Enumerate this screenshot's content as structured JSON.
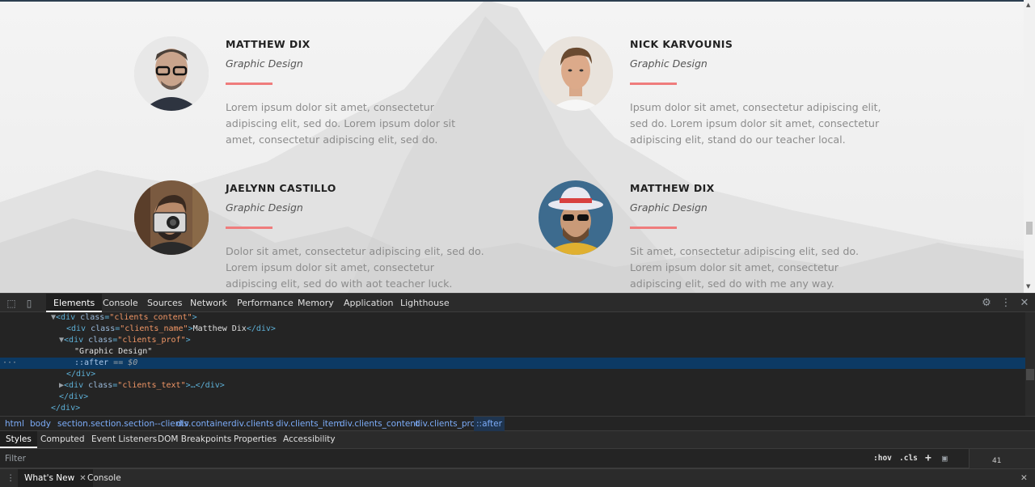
{
  "site": {
    "clients": [
      {
        "name": "MATTHEW DIX",
        "profession": "Graphic Design",
        "text": "Lorem ipsum dolor sit amet, consectetur adipiscing elit, sed do. Lorem ipsum dolor sit amet, consectetur adipiscing elit, sed do."
      },
      {
        "name": "NICK KARVOUNIS",
        "profession": "Graphic Design",
        "text": "Ipsum dolor sit amet, consectetur adipiscing elit, sed do. Lorem ipsum dolor sit amet, consectetur adipiscing elit, stand do our teacher local."
      },
      {
        "name": "JAELYNN CASTILLO",
        "profession": "Graphic Design",
        "text": "Dolor sit amet, consectetur adipiscing elit, sed do. Lorem ipsum dolor sit amet, consectetur adipiscing elit, sed do with aot teacher luck."
      },
      {
        "name": "MATTHEW DIX",
        "profession": "Graphic Design",
        "text": "Sit amet, consectetur adipiscing elit, sed do. Lorem ipsum dolor sit amet, consectetur adipiscing elit, sed do with me any way."
      }
    ],
    "accent_color": "#ef7c7c"
  },
  "devtools": {
    "tabs": [
      "Elements",
      "Console",
      "Sources",
      "Network",
      "Performance",
      "Memory",
      "Application",
      "Lighthouse"
    ],
    "dom": {
      "l1": {
        "tag_open": "<div",
        "attr": "class",
        "value": "\"clients_content\"",
        "close": ">"
      },
      "l2": {
        "tag_open": "<div",
        "attr": "class",
        "value": "\"clients_name\"",
        "close": ">",
        "text": "Matthew Dix",
        "end": "</div>"
      },
      "l3": {
        "tag_open": "<div",
        "attr": "class",
        "value": "\"clients_prof\"",
        "close": ">"
      },
      "l4": {
        "text": "\"Graphic Design\""
      },
      "l5": {
        "pseudo": "::after",
        "eq": " == $0"
      },
      "l6": {
        "end": "</div>"
      },
      "l7": {
        "tag_open": "<div",
        "attr": "class",
        "value": "\"clients_text\"",
        "close": ">…</div>"
      },
      "l8": {
        "end": "</div>"
      },
      "l9": {
        "end": "</div>"
      },
      "ellipsis": "···"
    },
    "breadcrumbs": [
      "html",
      "body",
      "section.section.section--clients",
      "div.container",
      "div.clients",
      "div.clients_item",
      "div.clients_content",
      "div.clients_prof",
      "::after"
    ],
    "sub_tabs": [
      "Styles",
      "Computed",
      "Event Listeners",
      "DOM Breakpoints",
      "Properties",
      "Accessibility"
    ],
    "filter_placeholder": "Filter",
    "filter_buttons": {
      "hov": ":hov",
      "cls": ".cls",
      "plus": "+"
    },
    "box_model_value": "41",
    "drawer_tabs": {
      "whats_new": "What's New",
      "console": "Console"
    }
  }
}
